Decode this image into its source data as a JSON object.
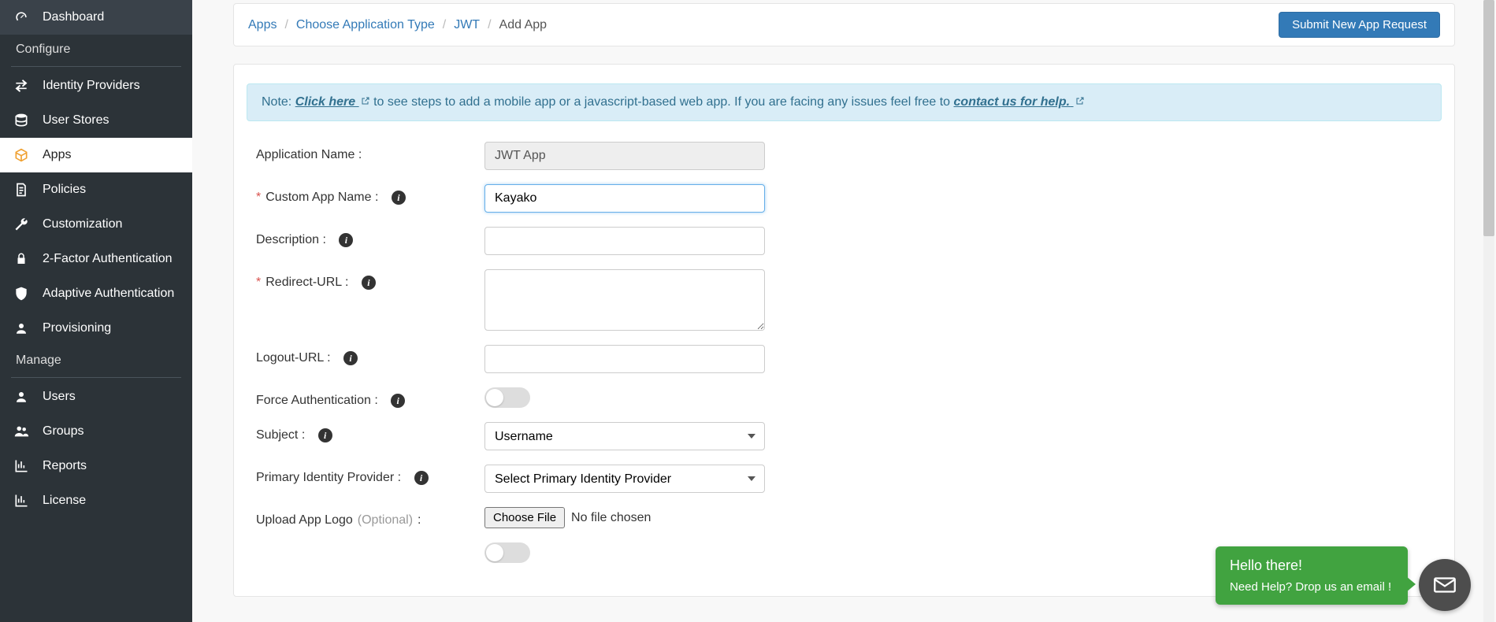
{
  "sidebar": {
    "items": [
      {
        "label": "Dashboard",
        "icon": "dashboard"
      },
      {
        "header": "Configure"
      },
      {
        "label": "Identity Providers",
        "icon": "exchange"
      },
      {
        "label": "User Stores",
        "icon": "db"
      },
      {
        "label": "Apps",
        "icon": "cube",
        "active": true
      },
      {
        "label": "Policies",
        "icon": "doc"
      },
      {
        "label": "Customization",
        "icon": "wrench"
      },
      {
        "label": "2-Factor Authentication",
        "icon": "lock"
      },
      {
        "label": "Adaptive Authentication",
        "icon": "shield"
      },
      {
        "label": "Provisioning",
        "icon": "user"
      },
      {
        "header": "Manage"
      },
      {
        "label": "Users",
        "icon": "user"
      },
      {
        "label": "Groups",
        "icon": "users"
      },
      {
        "label": "Reports",
        "icon": "chart"
      },
      {
        "label": "License",
        "icon": "chart"
      }
    ]
  },
  "breadcrumb": {
    "apps": "Apps",
    "choose": "Choose Application Type",
    "jwt": "JWT",
    "current": "Add App"
  },
  "topbutton": "Submit New App Request",
  "alert": {
    "note": "Note: ",
    "click_here": "Click here ",
    "mid": " to see steps to add a mobile app or a javascript-based web app. If you are facing any issues feel free to ",
    "contact": "contact us for help."
  },
  "form": {
    "app_name_label": "Application Name :",
    "app_name_value": "JWT App",
    "custom_label": "Custom App Name :",
    "custom_value": "Kayako",
    "desc_label": "Description :",
    "desc_value": "",
    "redirect_label": "Redirect-URL :",
    "redirect_value": "",
    "logout_label": "Logout-URL :",
    "logout_value": "",
    "force_label": "Force Authentication :",
    "subject_label": "Subject :",
    "subject_value": "Username",
    "idp_label": "Primary Identity Provider :",
    "idp_value": "Select Primary Identity Provider",
    "upload_label": "Upload App Logo ",
    "upload_optional": "(Optional)",
    "choose_file": "Choose File",
    "no_file": "No file chosen"
  },
  "help": {
    "title": "Hello there!",
    "body": "Need Help? Drop us an email !"
  }
}
